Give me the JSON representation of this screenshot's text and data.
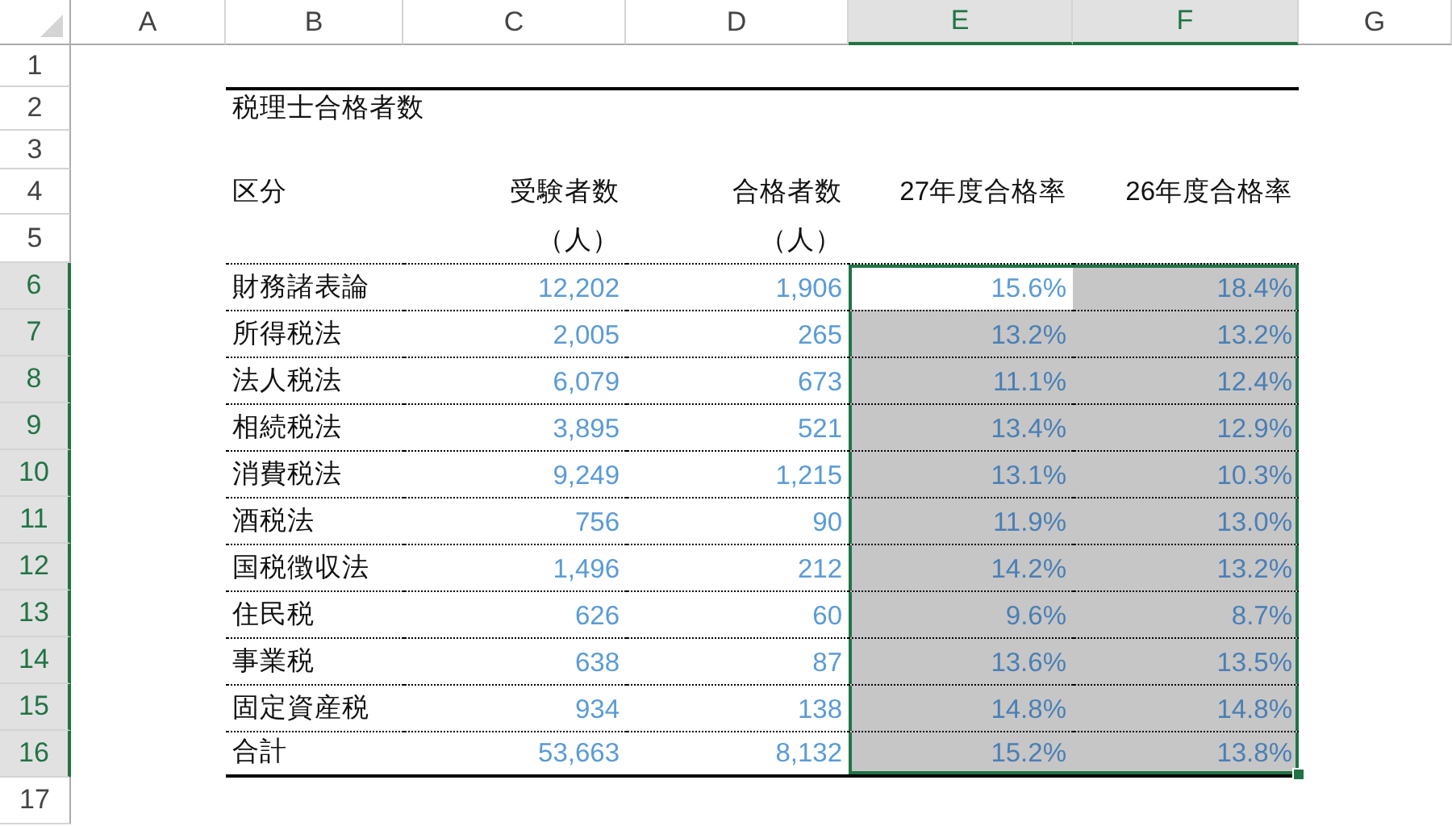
{
  "columns": [
    {
      "label": "A",
      "selected": false
    },
    {
      "label": "B",
      "selected": false
    },
    {
      "label": "C",
      "selected": false
    },
    {
      "label": "D",
      "selected": false
    },
    {
      "label": "E",
      "selected": true
    },
    {
      "label": "F",
      "selected": true
    },
    {
      "label": "G",
      "selected": false
    }
  ],
  "rows": [
    {
      "label": "1",
      "selected": false
    },
    {
      "label": "2",
      "selected": false
    },
    {
      "label": "3",
      "selected": false
    },
    {
      "label": "4",
      "selected": false
    },
    {
      "label": "5",
      "selected": false
    },
    {
      "label": "6",
      "selected": true
    },
    {
      "label": "7",
      "selected": true
    },
    {
      "label": "8",
      "selected": true
    },
    {
      "label": "9",
      "selected": true
    },
    {
      "label": "10",
      "selected": true
    },
    {
      "label": "11",
      "selected": true
    },
    {
      "label": "12",
      "selected": true
    },
    {
      "label": "13",
      "selected": true
    },
    {
      "label": "14",
      "selected": true
    },
    {
      "label": "15",
      "selected": true
    },
    {
      "label": "16",
      "selected": true
    },
    {
      "label": "17",
      "selected": false
    }
  ],
  "table": {
    "title": "税理士合格者数",
    "headings": [
      "区分",
      "受験者数",
      "合格者数",
      "27年度合格率",
      "26年度合格率"
    ],
    "units": [
      "（人）",
      "（人）"
    ],
    "data": [
      {
        "label": "財務諸表論",
        "examinees": "12,202",
        "passers": "1,906",
        "rates": [
          {
            "text": "15.6%",
            "selected": true,
            "active": true
          },
          {
            "text": "18.4%",
            "selected": true,
            "active": false
          }
        ]
      },
      {
        "label": "所得税法",
        "examinees": "2,005",
        "passers": "265",
        "rates": [
          {
            "text": "13.2%",
            "selected": true,
            "active": false
          },
          {
            "text": "13.2%",
            "selected": true,
            "active": false
          }
        ]
      },
      {
        "label": "法人税法",
        "examinees": "6,079",
        "passers": "673",
        "rates": [
          {
            "text": "11.1%",
            "selected": true,
            "active": false
          },
          {
            "text": "12.4%",
            "selected": true,
            "active": false
          }
        ]
      },
      {
        "label": "相続税法",
        "examinees": "3,895",
        "passers": "521",
        "rates": [
          {
            "text": "13.4%",
            "selected": true,
            "active": false
          },
          {
            "text": "12.9%",
            "selected": true,
            "active": false
          }
        ]
      },
      {
        "label": "消費税法",
        "examinees": "9,249",
        "passers": "1,215",
        "rates": [
          {
            "text": "13.1%",
            "selected": true,
            "active": false
          },
          {
            "text": "10.3%",
            "selected": true,
            "active": false
          }
        ]
      },
      {
        "label": "酒税法",
        "examinees": "756",
        "passers": "90",
        "rates": [
          {
            "text": "11.9%",
            "selected": true,
            "active": false
          },
          {
            "text": "13.0%",
            "selected": true,
            "active": false
          }
        ]
      },
      {
        "label": "国税徴収法",
        "examinees": "1,496",
        "passers": "212",
        "rates": [
          {
            "text": "14.2%",
            "selected": true,
            "active": false
          },
          {
            "text": "13.2%",
            "selected": true,
            "active": false
          }
        ]
      },
      {
        "label": "住民税",
        "examinees": "626",
        "passers": "60",
        "rates": [
          {
            "text": "9.6%",
            "selected": true,
            "active": false
          },
          {
            "text": "8.7%",
            "selected": true,
            "active": false
          }
        ]
      },
      {
        "label": "事業税",
        "examinees": "638",
        "passers": "87",
        "rates": [
          {
            "text": "13.6%",
            "selected": true,
            "active": false
          },
          {
            "text": "13.5%",
            "selected": true,
            "active": false
          }
        ]
      },
      {
        "label": "固定資産税",
        "examinees": "934",
        "passers": "138",
        "rates": [
          {
            "text": "14.8%",
            "selected": true,
            "active": false
          },
          {
            "text": "14.8%",
            "selected": true,
            "active": false
          }
        ]
      },
      {
        "label": "合計",
        "examinees": "53,663",
        "passers": "8,132",
        "rates": [
          {
            "text": "15.2%",
            "selected": true,
            "active": false
          },
          {
            "text": "13.8%",
            "selected": true,
            "active": false
          }
        ]
      }
    ]
  }
}
